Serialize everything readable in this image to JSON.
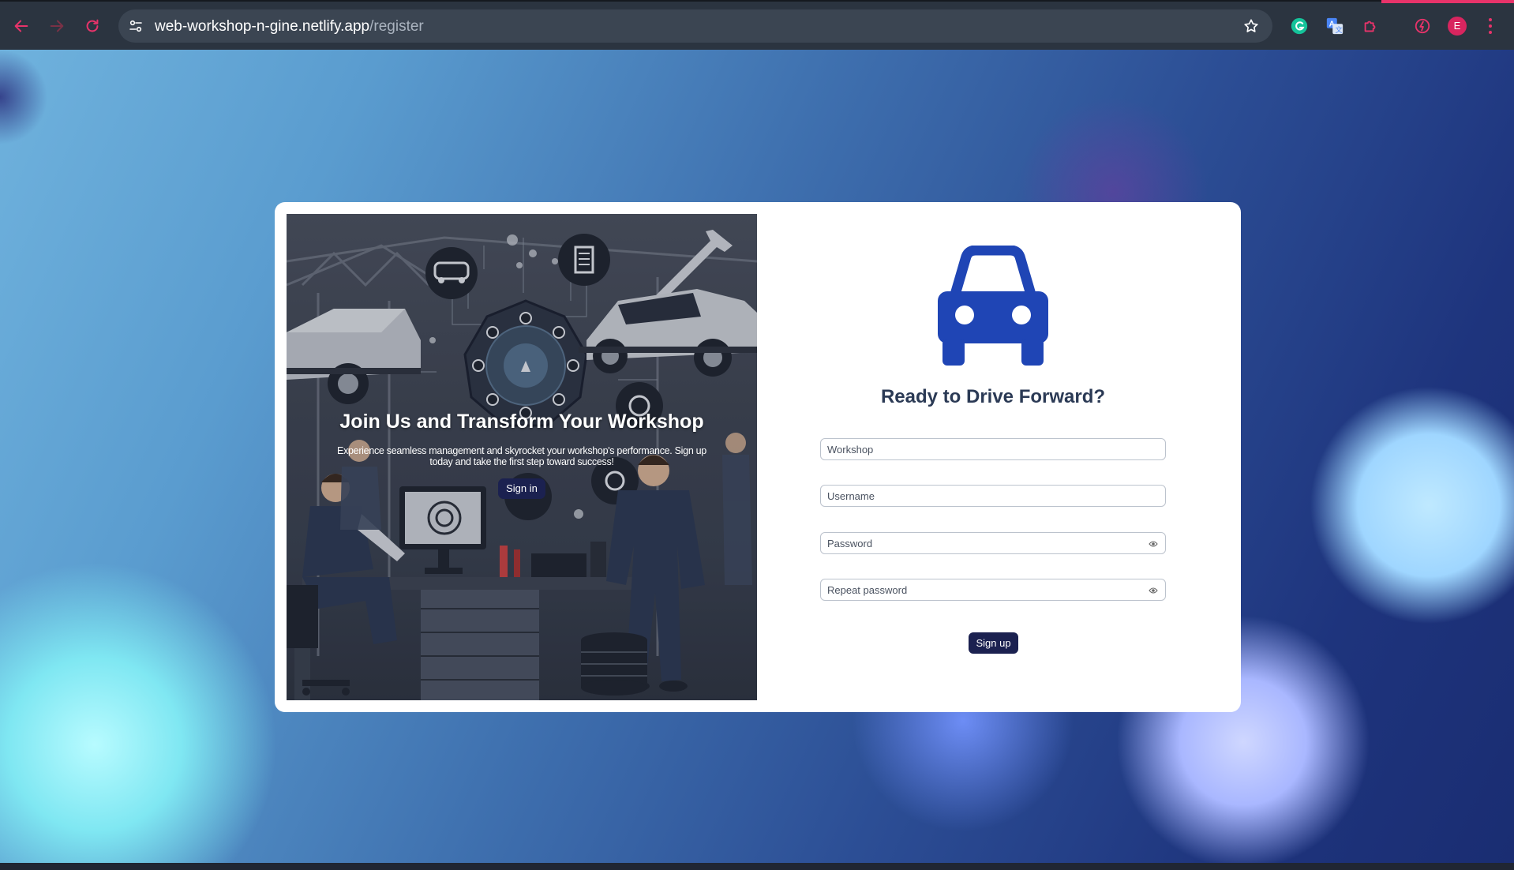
{
  "browser": {
    "url_host": "web-workshop-n-gine.netlify.app",
    "url_path": "/register",
    "profile_initial": "E",
    "icons": [
      "back-arrow-icon",
      "forward-arrow-icon",
      "reload-icon",
      "site-settings-icon",
      "bookmark-star-icon",
      "grammarly-icon",
      "translate-icon",
      "extensions-puzzle-icon",
      "performance-icon",
      "menu-dots-icon"
    ],
    "accent_color": "#e8336a"
  },
  "hero": {
    "title": "Join Us and Transform Your Workshop",
    "text": "Experience seamless management and skyrocket your workshop's performance. Sign up today and take the first step toward success!",
    "signin_label": "Sign in",
    "image": "workshop-illustration"
  },
  "form": {
    "logo": "car-icon",
    "title": "Ready to Drive Forward?",
    "workshop_placeholder": "Workshop",
    "username_placeholder": "Username",
    "password_placeholder": "Password",
    "repeat_password_placeholder": "Repeat password",
    "signup_label": "Sign up",
    "brand_color": "#1f45b5",
    "button_color": "#1b2150"
  }
}
